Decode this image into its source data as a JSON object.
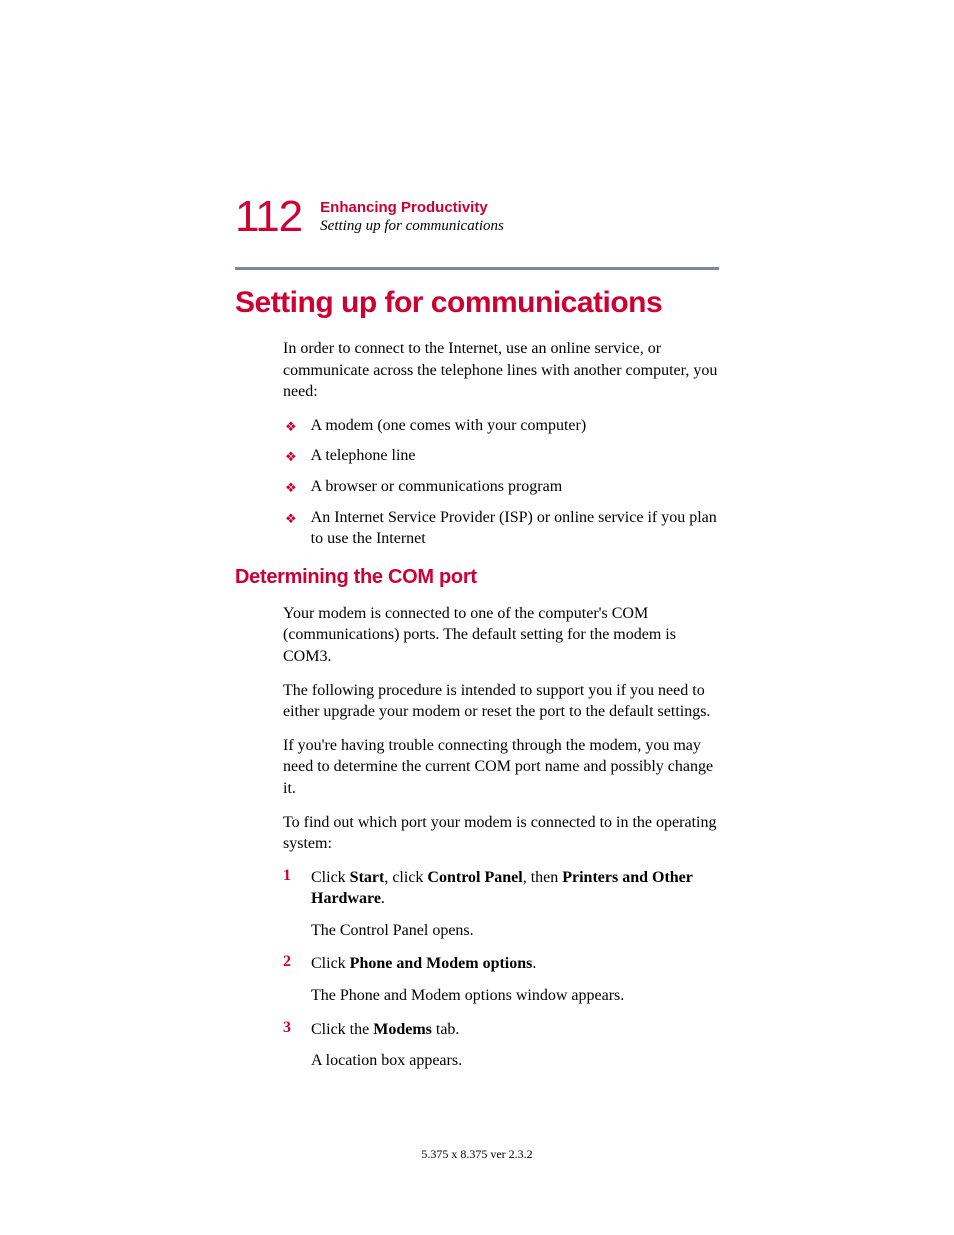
{
  "header": {
    "pageNumber": "112",
    "chapter": "Enhancing Productivity",
    "subtitle": "Setting up for communications"
  },
  "mainHeading": "Setting up for communications",
  "introPara": "In order to connect to the Internet, use an online service, or communicate across the telephone lines with another computer, you need:",
  "bullets": {
    "b0": "A modem (one comes with your computer)",
    "b1": "A telephone line",
    "b2": "A browser or communications program",
    "b3": "An Internet Service Provider (ISP) or online service if you plan to use the Internet"
  },
  "subHeading": "Determining the COM port",
  "paras": {
    "p0": "Your modem is connected to one of the computer's COM (communications) ports. The default setting for the modem is COM3.",
    "p1": "The following procedure is intended to support you if you need to either upgrade your modem or reset the port to the default settings.",
    "p2": "If you're having trouble connecting through the modem, you may need to determine the current COM port name and possibly change it.",
    "p3": "To find out which port your modem is connected to in the operating system:"
  },
  "steps": {
    "s1_pre": "Click ",
    "s1_b1": "Start",
    "s1_mid1": ", click ",
    "s1_b2": "Control Panel",
    "s1_mid2": ", then ",
    "s1_b3": "Printers and Other Hardware",
    "s1_post": ".",
    "s1_result": "The Control Panel opens.",
    "s2_pre": "Click ",
    "s2_b1": "Phone and Modem options",
    "s2_post": ".",
    "s2_result": "The Phone and Modem options window appears.",
    "s3_pre": "Click the ",
    "s3_b1": "Modems",
    "s3_post": " tab.",
    "s3_result": "A location box appears."
  },
  "numbers": {
    "n1": "1",
    "n2": "2",
    "n3": "3"
  },
  "footer": "5.375 x 8.375 ver 2.3.2"
}
